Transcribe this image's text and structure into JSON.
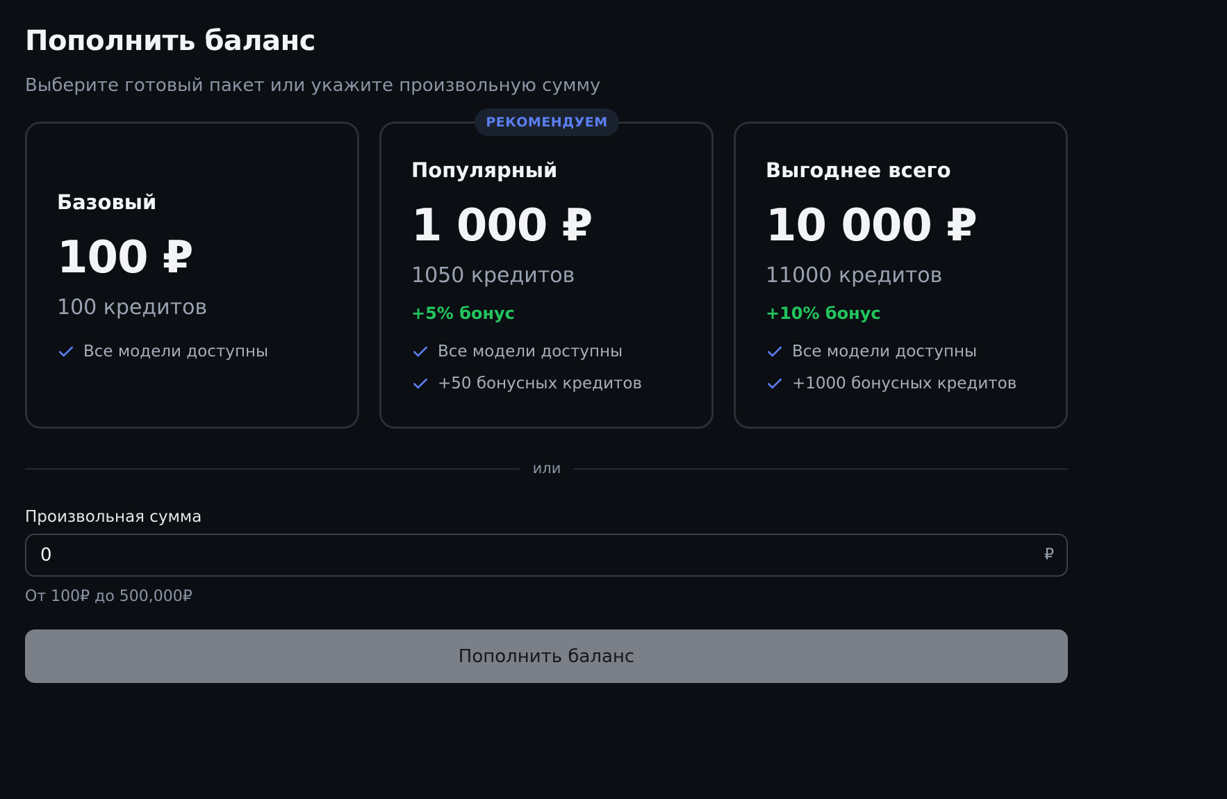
{
  "header": {
    "title": "Пополнить баланс",
    "subtitle": "Выберите готовый пакет или укажите произвольную сумму"
  },
  "packages": [
    {
      "name": "Базовый",
      "price": "100 ₽",
      "credits": "100 кредитов",
      "bonus": "",
      "features": [
        "Все модели доступны"
      ]
    },
    {
      "name": "Популярный",
      "badge": "РЕКОМЕНДУЕМ",
      "price": "1 000 ₽",
      "credits": "1050 кредитов",
      "bonus": "+5% бонус",
      "features": [
        "Все модели доступны",
        "+50 бонусных кредитов"
      ]
    },
    {
      "name": "Выгоднее всего",
      "price": "10 000 ₽",
      "credits": "11000 кредитов",
      "bonus": "+10% бонус",
      "features": [
        "Все модели доступны",
        "+1000 бонусных кредитов"
      ]
    }
  ],
  "divider": {
    "text": "или"
  },
  "custom": {
    "label": "Произвольная сумма",
    "value": "0",
    "currency": "₽",
    "hint": "От 100₽ до 500,000₽"
  },
  "submit": {
    "label": "Пополнить баланс"
  },
  "icons": {
    "feature": "check-icon"
  },
  "colors": {
    "background": "#0b0e12",
    "card_border": "#2a2f38",
    "accent": "#5b7ff0",
    "bonus": "#22c55e",
    "button": "#7b8088"
  }
}
